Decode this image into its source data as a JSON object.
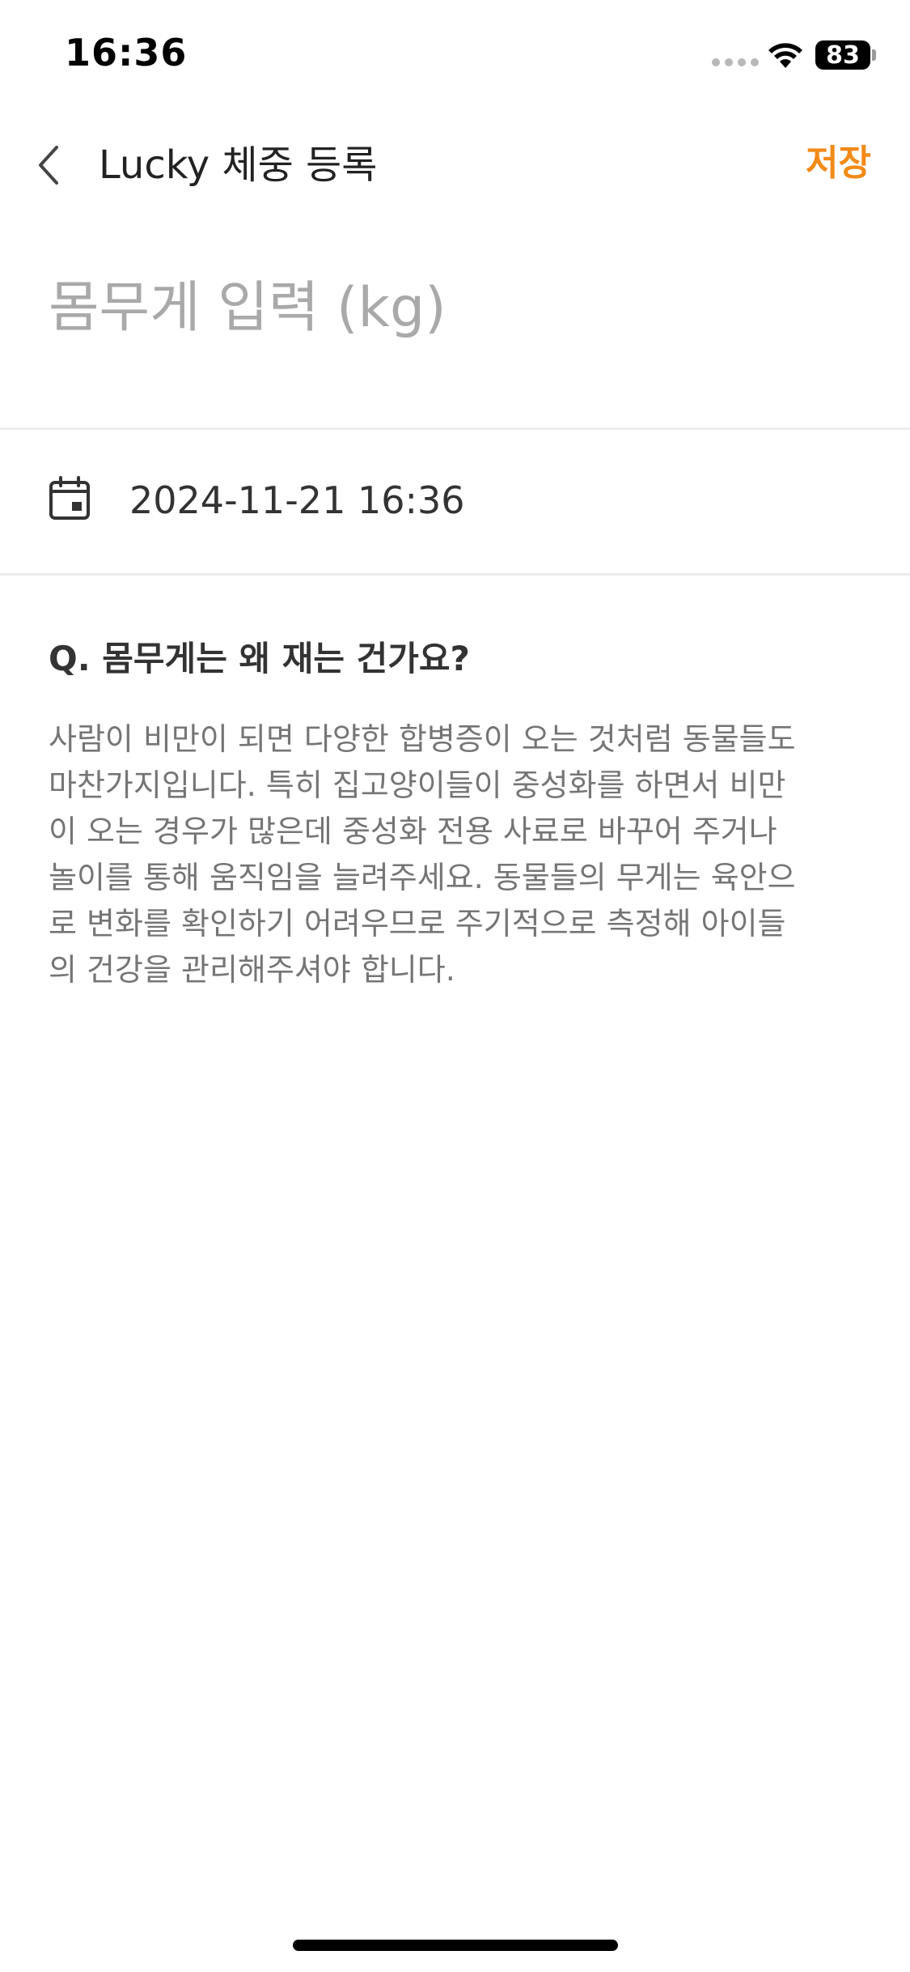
{
  "status_bar": {
    "time": "16:36",
    "battery_level": "83"
  },
  "header": {
    "back_icon": "chevron-left-icon",
    "title": "Lucky 체중 등록",
    "save_label": "저장"
  },
  "colors": {
    "accent": "#f28a18",
    "text_primary": "#333333",
    "text_secondary": "#757575",
    "placeholder": "#a9a9a9",
    "divider": "#ececec"
  },
  "weight_input": {
    "placeholder": "몸무게 입력 (kg)",
    "value": ""
  },
  "date_row": {
    "icon": "calendar-icon",
    "value": "2024-11-21 16:36"
  },
  "faq": {
    "question": "Q. 몸무게는 왜 재는 건가요?",
    "answer": "사람이 비만이 되면 다양한 합병증이 오는 것처럼 동물들도\n마찬가지입니다. 특히 집고양이들이 중성화를 하면서 비만\n이 오는 경우가 많은데 중성화 전용 사료로 바꾸어 주거나\n놀이를 통해 움직임을 늘려주세요. 동물들의 무게는 육안으\n로 변화를 확인하기 어려우므로 주기적으로 측정해 아이들\n의 건강을 관리해주셔야 합니다."
  }
}
